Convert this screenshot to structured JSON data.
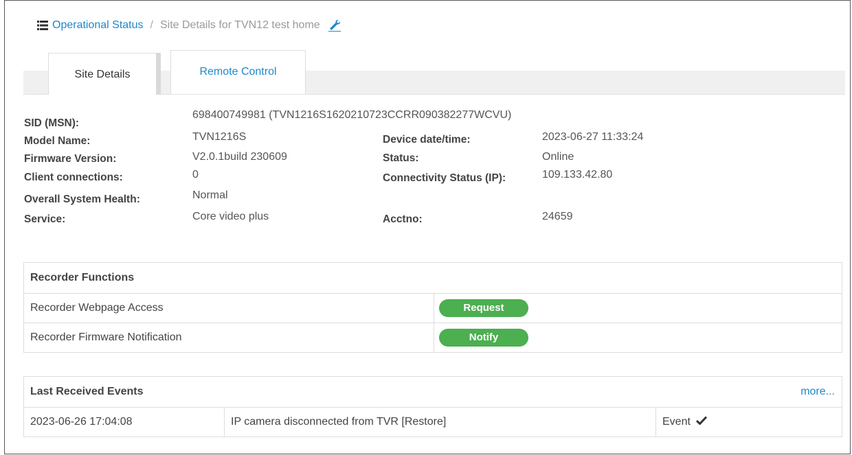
{
  "breadcrumb": {
    "root_label": "Operational Status",
    "separator": "/",
    "current_label": "Site Details for TVN12 test home"
  },
  "tabs": [
    {
      "label": "Site Details",
      "active": true
    },
    {
      "label": "Remote Control",
      "active": false
    }
  ],
  "details": {
    "sid_label": "SID (MSN):",
    "sid_value": "698400749981 (TVN1216S1620210723CCRR090382277WCVU)",
    "model_label": "Model Name:",
    "model_value": "TVN1216S",
    "firmware_label": "Firmware Version:",
    "firmware_value": "V2.0.1build 230609",
    "clients_label": "Client connections:",
    "clients_value": "0",
    "health_label": "Overall System Health:",
    "health_value": "Normal",
    "service_label": "Service:",
    "service_value": "Core video plus",
    "datetime_label": "Device date/time:",
    "datetime_value": "2023-06-27 11:33:24",
    "status_label": "Status:",
    "status_value": "Online",
    "connectivity_label": "Connectivity Status (IP):",
    "connectivity_value": "109.133.42.80",
    "acctno_label": "Acctno:",
    "acctno_value": "24659"
  },
  "recorder_functions": {
    "title": "Recorder Functions",
    "rows": [
      {
        "label": "Recorder Webpage Access",
        "button": "Request"
      },
      {
        "label": "Recorder Firmware Notification",
        "button": "Notify"
      }
    ]
  },
  "events": {
    "title": "Last Received Events",
    "more_label": "more...",
    "rows": [
      {
        "time": "2023-06-26 17:04:08",
        "description": "IP camera disconnected from TVR [Restore]",
        "type": "Event"
      }
    ]
  },
  "colors": {
    "accent": "#1e88c8",
    "button_green": "#4caf50"
  },
  "icons": [
    "list-icon",
    "wrench-icon",
    "checkmark-icon"
  ]
}
